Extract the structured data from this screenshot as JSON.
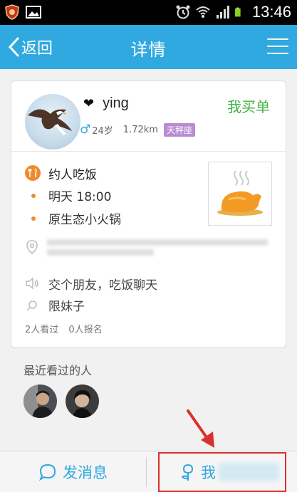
{
  "status_bar": {
    "time": "13:46"
  },
  "header": {
    "back_label": "返回",
    "title": "详情"
  },
  "profile": {
    "username": "ying",
    "age": "24岁",
    "distance": "1.72km",
    "zodiac": "天秤座",
    "buy_label": "我买单"
  },
  "event": {
    "title": "约人吃饭",
    "time": "明天 18:00",
    "place": "原生态小火锅",
    "message": "交个朋友，吃饭聊天",
    "restriction": "限妹子",
    "views": "2人看过",
    "signups": "0人报名"
  },
  "recent": {
    "title": "最近看过的人"
  },
  "bottom_bar": {
    "message_label": "发消息",
    "signup_label": "我"
  },
  "colors": {
    "accent": "#2fa9e0",
    "buy": "#3fb13f",
    "orange": "#f08a2c",
    "badge": "#b98bd1",
    "highlight": "#d9312b"
  }
}
